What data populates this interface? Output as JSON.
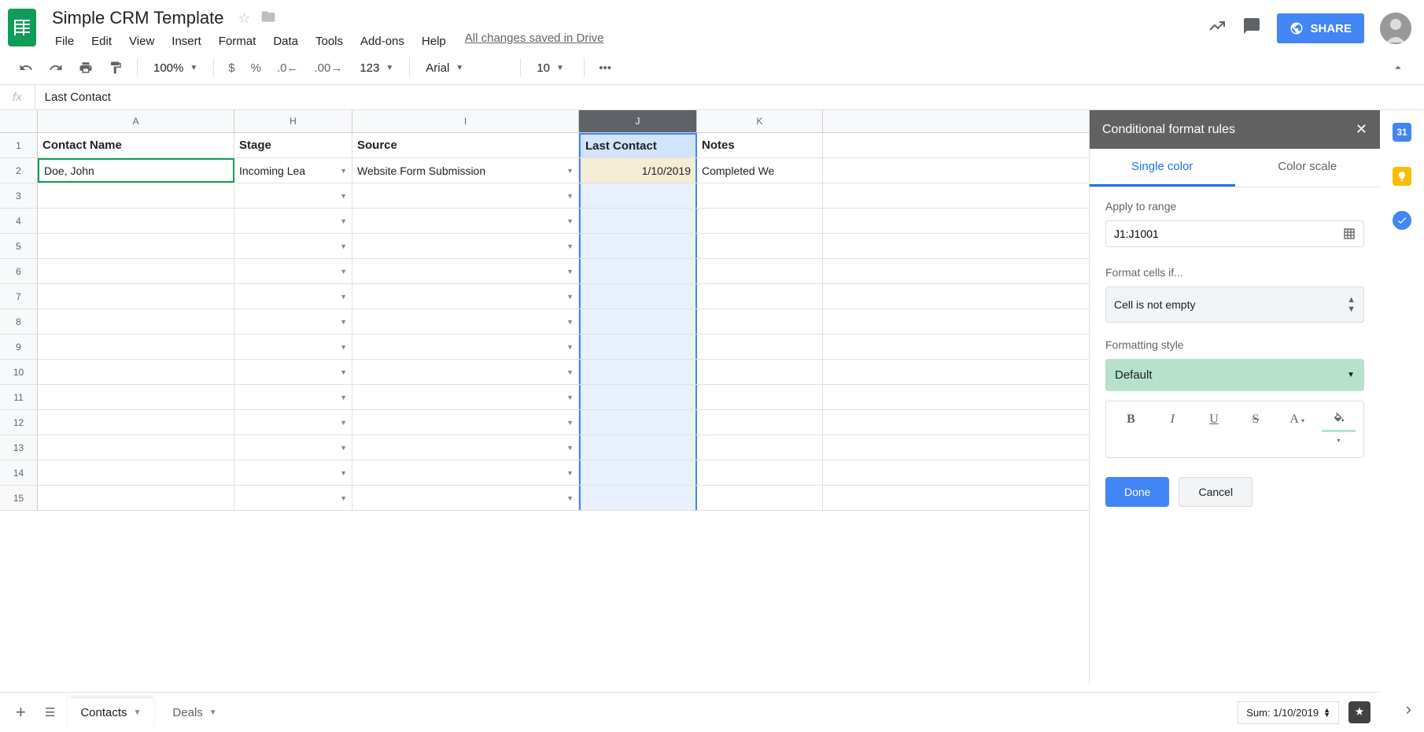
{
  "doc_title": "Simple CRM Template",
  "menu": [
    "File",
    "Edit",
    "View",
    "Insert",
    "Format",
    "Data",
    "Tools",
    "Add-ons",
    "Help"
  ],
  "save_status": "All changes saved in Drive",
  "share_label": "SHARE",
  "toolbar": {
    "zoom": "100%",
    "font": "Arial",
    "font_size": "10"
  },
  "formula_bar": {
    "fx": "fx",
    "value": "Last Contact"
  },
  "columns": [
    {
      "letter": "A",
      "cls": "c-A",
      "selected": false
    },
    {
      "letter": "H",
      "cls": "c-H",
      "selected": false
    },
    {
      "letter": "I",
      "cls": "c-I",
      "selected": false
    },
    {
      "letter": "J",
      "cls": "c-J",
      "selected": true
    },
    {
      "letter": "K",
      "cls": "c-K",
      "selected": false
    }
  ],
  "headers": [
    "Contact Name",
    "Stage",
    "Source",
    "Last Contact",
    "Notes"
  ],
  "data_row": {
    "contact": "Doe, John",
    "stage": "Incoming Lea",
    "source": "Website Form Submission",
    "last_contact": "1/10/2019",
    "notes": "Completed We"
  },
  "row_count": 15,
  "panel": {
    "title": "Conditional format rules",
    "tabs": [
      "Single color",
      "Color scale"
    ],
    "apply_label": "Apply to range",
    "range": "J1:J1001",
    "format_if_label": "Format cells if...",
    "condition": "Cell is not empty",
    "style_label": "Formatting style",
    "style_value": "Default",
    "done": "Done",
    "cancel": "Cancel"
  },
  "sheets": [
    "Contacts",
    "Deals"
  ],
  "sum_label": "Sum: 1/10/2019",
  "rail_calendar": "31"
}
